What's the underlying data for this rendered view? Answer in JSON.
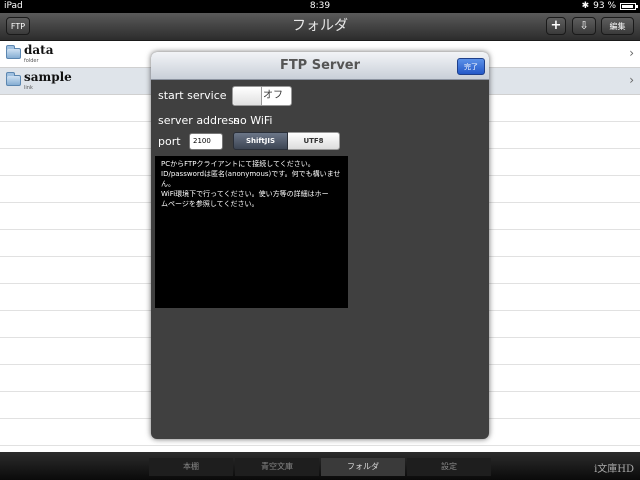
{
  "status_bar": {
    "carrier": "iPad",
    "time": "8:39",
    "battery": "93 %",
    "icons": [
      "bluetooth-icon",
      "battery-icon"
    ]
  },
  "nav": {
    "left_button": "FTP",
    "title": "フォルダ",
    "add_glyph": "+",
    "download_glyph": "⇩",
    "edit_button": "編集"
  },
  "files": [
    {
      "name": "data",
      "type": "folder"
    },
    {
      "name": "sample",
      "type": "link"
    }
  ],
  "modal": {
    "title": "FTP Server",
    "done_button": "完了",
    "start_service_label": "start service",
    "toggle_state": "オフ",
    "server_address_label": "server address",
    "server_address_value": "no WiFi",
    "port_label": "port",
    "port_value": "2100",
    "encoding_options": [
      "ShiftJIS",
      "UTF8"
    ],
    "encoding_selected": "ShiftJIS",
    "info_lines": [
      "PCからFTPクライアントにて接続してください。",
      "ID/passwordは匿名(anonymous)です。何でも構いませ",
      "ん。",
      "WiFi環境下で行ってください。使い方等の詳細はホー",
      "ムページを参照してください。"
    ]
  },
  "tabs": [
    {
      "label": "本棚",
      "active": false
    },
    {
      "label": "青空文庫",
      "active": false
    },
    {
      "label": "フォルダ",
      "active": true
    },
    {
      "label": "設定",
      "active": false
    }
  ],
  "app_logo": "i文庫HD",
  "colors": {
    "done_button": "#2c5fd4",
    "modal_bg": "#404040",
    "selected_row": "#dfe4ea"
  }
}
